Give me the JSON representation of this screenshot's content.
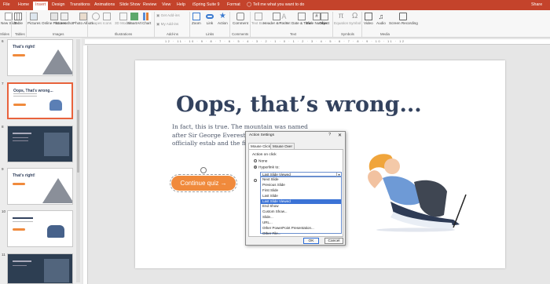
{
  "titlebar": {
    "tabs": [
      "File",
      "Home",
      "Insert",
      "Design",
      "Transitions",
      "Animations",
      "Slide Show",
      "Review",
      "View",
      "Help",
      "iSpring Suite 9",
      "Format"
    ],
    "active_tab": "Insert",
    "tell_me": "Tell me what you want to do",
    "share": "Share"
  },
  "ribbon": {
    "buttons": [
      "New Slide",
      "Table",
      "Pictures",
      "Online Pictures",
      "Screenshot",
      "Photo Album",
      "Shapes",
      "Icons",
      "3D Models",
      "SmartArt",
      "Chart",
      "Get Add-ins",
      "My Add-ins",
      "Zoom",
      "Link",
      "Action",
      "Comment",
      "Text Box",
      "Header & Footer",
      "WordArt",
      "Date & Time",
      "Slide Number",
      "Object",
      "Equation",
      "Symbol",
      "Video",
      "Audio",
      "Screen Recording"
    ],
    "groups": [
      "Slides",
      "Tables",
      "Images",
      "Illustrations",
      "Add-ins",
      "Links",
      "Comments",
      "Text",
      "Symbols",
      "Media"
    ]
  },
  "thumbnails": [
    {
      "num": "6",
      "title": "That's right!"
    },
    {
      "num": "7",
      "title": "Oops, That's wrong..."
    },
    {
      "num": "8",
      "title": ""
    },
    {
      "num": "9",
      "title": "That's right!"
    },
    {
      "num": "10",
      "title": ""
    },
    {
      "num": "11",
      "title": ""
    }
  ],
  "ruler": {
    "ticks": "12 · 11 · 10 · 9 · 8 · 7 · 6 · 5 · 4 · 3 · 2 · 1 · 0 · 1 · 2 · 3 · 4 · 5 · 6 · 7 · 8 · 9 · 10 · 11 · 12"
  },
  "slide": {
    "heading": "Oops, that’s wrong...",
    "body": "In fact, this is true. The mountain was named after Sir George Everest, the lea team which officially estab and the first published heig",
    "button": "Continue quiz →"
  },
  "dialog": {
    "title": "Action Settings",
    "help": "?",
    "close": "✕",
    "tabs": [
      "Mouse Click",
      "Mouse Over"
    ],
    "action_label": "Action on click",
    "none_label": "None",
    "hyperlink_label": "Hyperlink to:",
    "combo_value": "Last Slide Viewed",
    "list_items": [
      "Next Slide",
      "Previous Slide",
      "First Slide",
      "Last Slide",
      "Last Slide Viewed",
      "End Show",
      "Custom Show...",
      "Slide...",
      "URL...",
      "Other PowerPoint Presentation...",
      "Other File..."
    ],
    "highlighted": "Last Slide Viewed",
    "ok": "OK",
    "cancel": "Cancel"
  }
}
